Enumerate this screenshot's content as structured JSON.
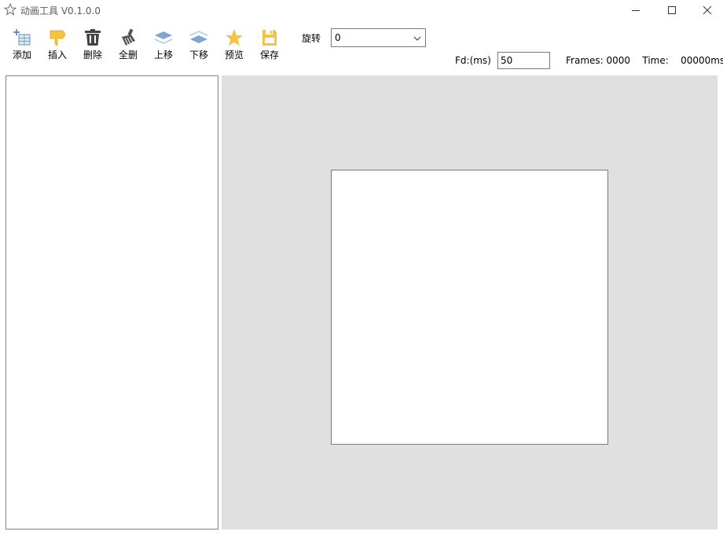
{
  "window": {
    "title": "动画工具 V0.1.0.0",
    "icon": "star-outline-icon"
  },
  "toolbar": {
    "items": [
      {
        "id": "add",
        "label": "添加",
        "icon": "add-frame-icon"
      },
      {
        "id": "insert",
        "label": "插入",
        "icon": "insert-flag-icon"
      },
      {
        "id": "delete",
        "label": "删除",
        "icon": "trash-icon"
      },
      {
        "id": "delete-all",
        "label": "全删",
        "icon": "broom-icon"
      },
      {
        "id": "move-up",
        "label": "上移",
        "icon": "layer-up-icon"
      },
      {
        "id": "move-down",
        "label": "下移",
        "icon": "layer-down-icon"
      },
      {
        "id": "preview",
        "label": "预览",
        "icon": "star-icon"
      },
      {
        "id": "save",
        "label": "保存",
        "icon": "floppy-icon"
      }
    ]
  },
  "rotation": {
    "label": "旋转",
    "value": "0"
  },
  "fd": {
    "label": "Fd:(ms)",
    "value": "50"
  },
  "status": {
    "frames_label": "Frames:",
    "frames_value": "0000",
    "time_label": "Time:",
    "time_value": "00000ms"
  },
  "colors": {
    "canvas_bg": "#e0e0e0",
    "icon_yellow": "#f5c242",
    "icon_blue": "#7ea6d4",
    "icon_dark": "#444444"
  }
}
